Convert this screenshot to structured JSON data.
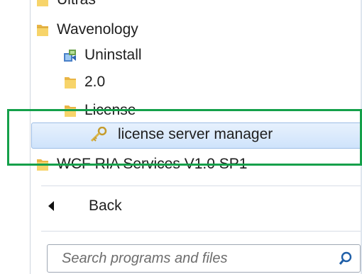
{
  "menu": {
    "items": [
      {
        "label": "Ultras"
      },
      {
        "label": "Wavenology"
      },
      {
        "label": "Uninstall"
      },
      {
        "label": "2.0"
      },
      {
        "label": "License"
      },
      {
        "label": "license server manager"
      },
      {
        "label": "WCF RIA Services V1.0 SP1"
      }
    ]
  },
  "back": {
    "label": "Back"
  },
  "search": {
    "placeholder": "Search programs and files"
  },
  "colors": {
    "highlight_box": "#14a04a",
    "selection": "#cfe3fb"
  }
}
